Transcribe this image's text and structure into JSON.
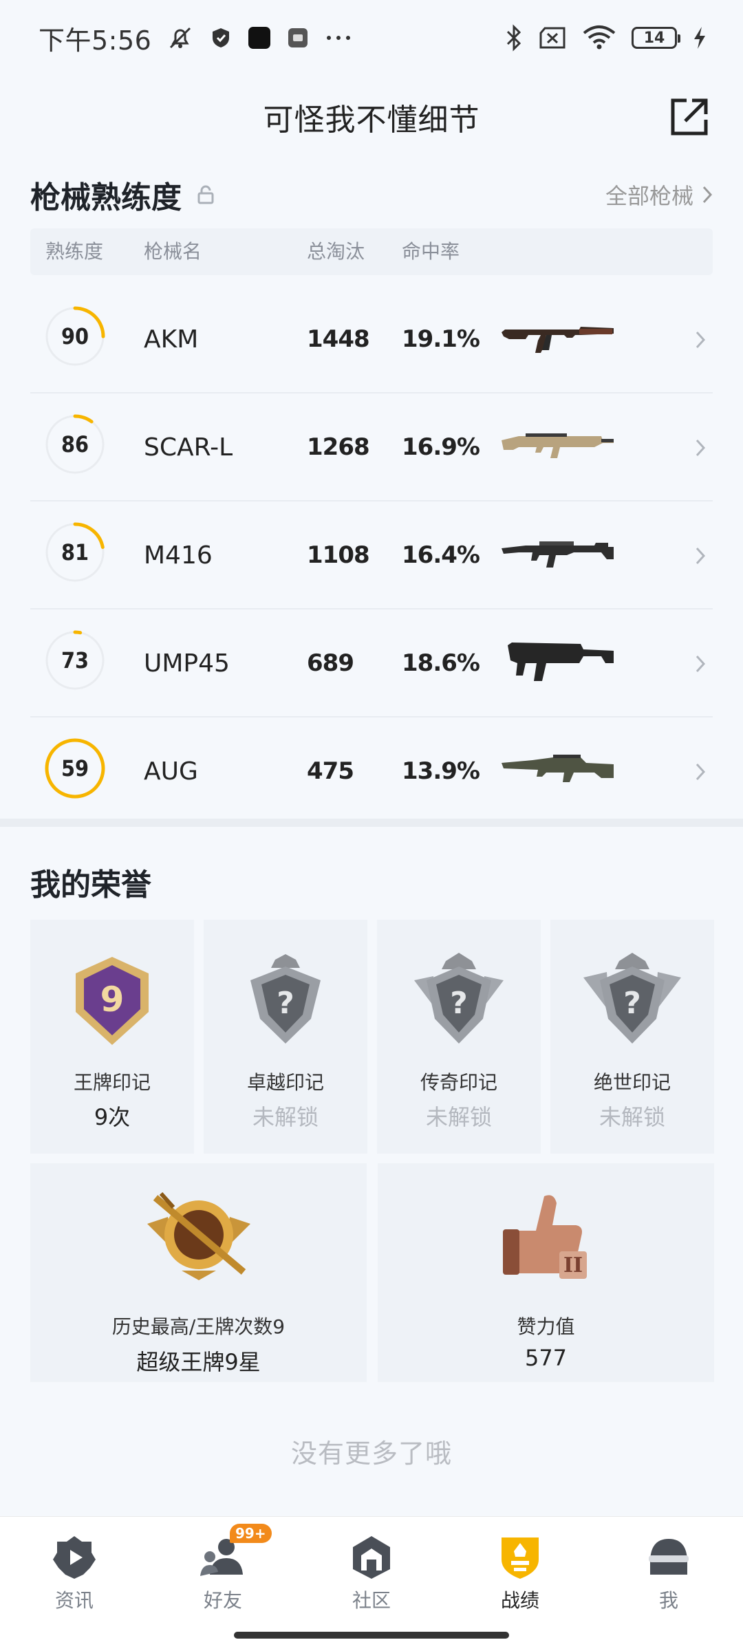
{
  "status_bar": {
    "time": "下午5:56",
    "battery": "14"
  },
  "header": {
    "title": "可怪我不懂细节"
  },
  "guns_section": {
    "title": "枪械熟练度",
    "all_link": "全部枪械",
    "columns": {
      "proficiency": "熟练度",
      "name": "枪械名",
      "kills": "总淘汰",
      "hit_rate": "命中率"
    },
    "rows": [
      {
        "proficiency": "90",
        "name": "AKM",
        "kills": "1448",
        "hit_rate": "19.1%",
        "ring_fraction": 0.25
      },
      {
        "proficiency": "86",
        "name": "SCAR-L",
        "kills": "1268",
        "hit_rate": "16.9%",
        "ring_fraction": 0.1
      },
      {
        "proficiency": "81",
        "name": "M416",
        "kills": "1108",
        "hit_rate": "16.4%",
        "ring_fraction": 0.22
      },
      {
        "proficiency": "73",
        "name": "UMP45",
        "kills": "689",
        "hit_rate": "18.6%",
        "ring_fraction": 0.03
      },
      {
        "proficiency": "59",
        "name": "AUG",
        "kills": "475",
        "hit_rate": "13.9%",
        "ring_fraction": 1.0
      }
    ]
  },
  "honor_section": {
    "title": "我的荣誉",
    "small_cards": [
      {
        "label": "王牌印记",
        "value": "9次",
        "locked": false,
        "badge_text": "9"
      },
      {
        "label": "卓越印记",
        "value": "未解锁",
        "locked": true,
        "badge_text": "?"
      },
      {
        "label": "传奇印记",
        "value": "未解锁",
        "locked": true,
        "badge_text": "?"
      },
      {
        "label": "绝世印记",
        "value": "未解锁",
        "locked": true,
        "badge_text": "?"
      }
    ],
    "big_cards": [
      {
        "label": "历史最高/王牌次数9",
        "value": "超级王牌9星"
      },
      {
        "label": "赞力值",
        "value": "577"
      }
    ]
  },
  "footer_note": "没有更多了哦",
  "bottom_nav": {
    "items": [
      {
        "label": "资讯",
        "active": false
      },
      {
        "label": "好友",
        "active": false,
        "badge": "99+"
      },
      {
        "label": "社区",
        "active": false
      },
      {
        "label": "战绩",
        "active": true
      },
      {
        "label": "我",
        "active": false
      }
    ]
  },
  "colors": {
    "accent": "#f7b500",
    "ring_track": "#e9ecf0",
    "background": "#f5f8fc"
  }
}
